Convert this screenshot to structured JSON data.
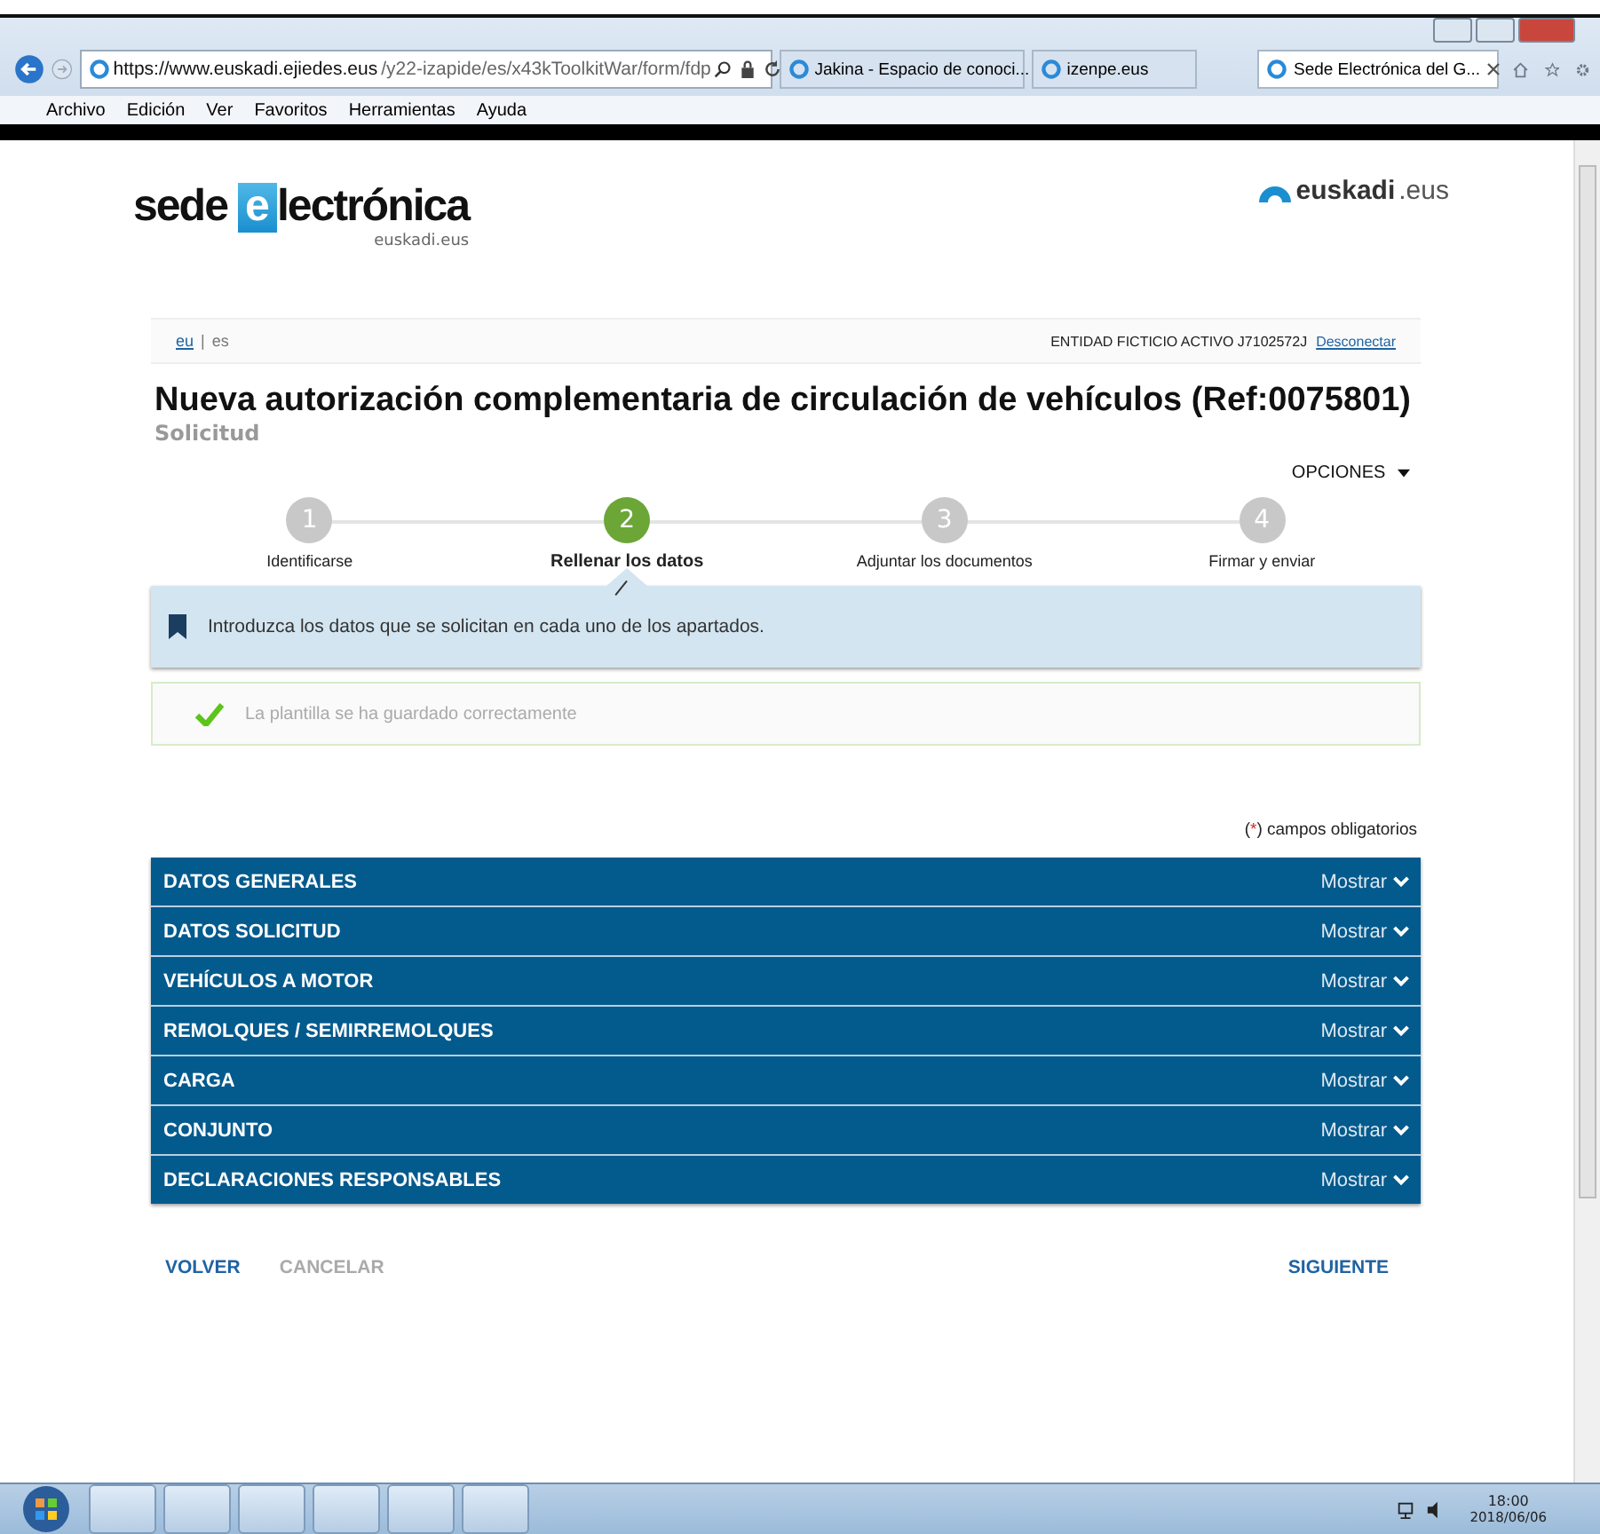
{
  "browser": {
    "address": {
      "host": "https://www.euskadi.ejiedes.eus",
      "path": "/y22-izapide/es/x43kToolkitWar/form/fdp"
    },
    "tabs": [
      {
        "label": "Jakina - Espacio de conoci...",
        "selected": false
      },
      {
        "label": "izenpe.eus",
        "selected": false
      },
      {
        "label": "Sede Electrónica del G...",
        "selected": true
      }
    ],
    "menu": [
      "Archivo",
      "Edición",
      "Ver",
      "Favoritos",
      "Herramientas",
      "Ayuda"
    ]
  },
  "header": {
    "logo_main": "sede",
    "logo_e": "e",
    "logo_rest": "lectrónica",
    "logo_sub": "euskadi.eus",
    "brand_bold": "euskadi",
    "brand_rest": ".eus"
  },
  "userbar": {
    "separator": "|",
    "languages": [
      {
        "label": "eu",
        "selected": false
      },
      {
        "label": "es",
        "selected": true
      }
    ],
    "entity": "ENTIDAD FICTICIO ACTIVO J7102572J",
    "logout": "Desconectar"
  },
  "title": "Nueva autorización complementaria de circulación de vehículos (Ref:0075801)",
  "subtitle": "Solicitud",
  "options": "OPCIONES",
  "steps": [
    {
      "number": "1",
      "label": "Identificarse",
      "selected": false
    },
    {
      "number": "2",
      "label": "Rellenar los datos",
      "selected": true
    },
    {
      "number": "3",
      "label": "Adjuntar los documentos",
      "selected": false
    },
    {
      "number": "4",
      "label": "Firmar y enviar",
      "selected": false
    }
  ],
  "info": "Introduzca los datos que se solicitan en cada uno de los apartados.",
  "success": "La plantilla se ha guardado correctamente",
  "required_note": {
    "open": "(",
    "mark": "*",
    "rest": ") campos obligatorios"
  },
  "sections": [
    {
      "title": "DATOS GENERALES",
      "action": "Mostrar",
      "expanded": false
    },
    {
      "title": "DATOS SOLICITUD",
      "action": "Mostrar",
      "expanded": false
    },
    {
      "title": "VEHÍCULOS A MOTOR",
      "action": "Mostrar",
      "expanded": false
    },
    {
      "title": "REMOLQUES / SEMIRREMOLQUES",
      "action": "Mostrar",
      "expanded": false
    },
    {
      "title": "CARGA",
      "action": "Mostrar",
      "expanded": false
    },
    {
      "title": "CONJUNTO",
      "action": "Mostrar",
      "expanded": false
    },
    {
      "title": "DECLARACIONES RESPONSABLES",
      "action": "Mostrar",
      "expanded": false
    }
  ],
  "actions": [
    {
      "label": "VOLVER",
      "disabled": false
    },
    {
      "label": "CANCELAR",
      "disabled": true
    },
    {
      "label": "SIGUIENTE",
      "disabled": false
    }
  ],
  "taskbar": {
    "time": "18:00",
    "date": "2018/06/06"
  }
}
